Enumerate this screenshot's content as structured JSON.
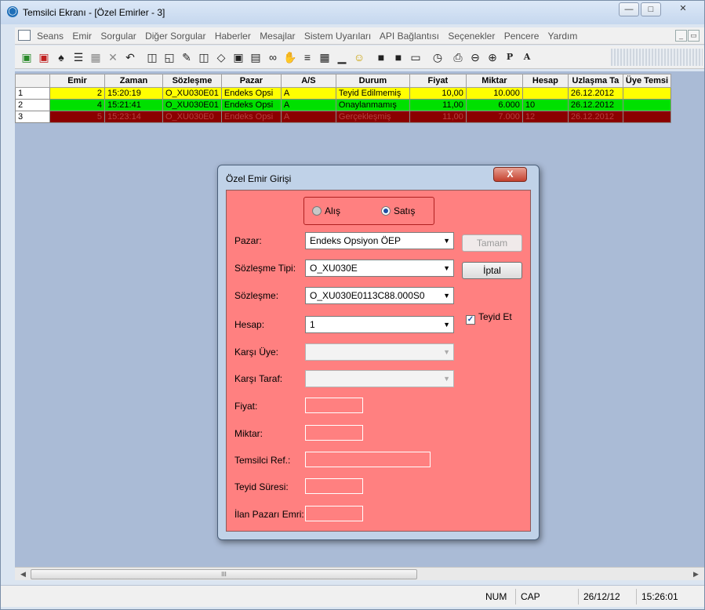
{
  "window": {
    "title": "Temsilci Ekranı - [Özel Emirler - 3]"
  },
  "menu": [
    "Seans",
    "Emir",
    "Sorgular",
    "Diğer Sorgular",
    "Haberler",
    "Mesajlar",
    "Sistem Uyarıları",
    "API Bağlantısı",
    "Seçenekler",
    "Pencere",
    "Yardım"
  ],
  "toolbar": {
    "icons": [
      "new-doc-icon",
      "red-doc-icon",
      "person-icon",
      "book-stack-icon",
      "properties-icon",
      "delete-icon",
      "undo-icon",
      "window-icon",
      "chat-icon",
      "pen-icon",
      "columns-icon",
      "bell-icon",
      "lock-doc-icon",
      "report-icon",
      "glasses-icon",
      "hand-icon",
      "list-icon",
      "grid-icon",
      "chart-icon",
      "smiley-icon",
      "book-icon",
      "book2-icon",
      "inbox-icon",
      "clock-icon",
      "printer-icon",
      "zoom-out-icon",
      "zoom-in-icon",
      "p-icon",
      "a-icon"
    ],
    "p_label": "P",
    "a_label": "A"
  },
  "grid": {
    "columns": [
      "",
      "Emir",
      "Zaman",
      "Sözleşme",
      "Pazar",
      "A/S",
      "Durum",
      "Fiyat",
      "Miktar",
      "Hesap",
      "Uzlaşma Ta",
      "Üye Temsi"
    ],
    "rows": [
      {
        "num": "1",
        "emir": "2",
        "zaman": "15:20:19",
        "sozlesme": "O_XU030E01",
        "pazar": "Endeks Opsi",
        "as": "A",
        "durum": "Teyid Edilmemiş",
        "fiyat": "10,00",
        "miktar": "10.000",
        "hesap": "",
        "uzlasma": "26.12.2012",
        "uye": "",
        "color": "yellow"
      },
      {
        "num": "2",
        "emir": "4",
        "zaman": "15:21:41",
        "sozlesme": "O_XU030E01",
        "pazar": "Endeks Opsi",
        "as": "A",
        "durum": "Onaylanmamış",
        "fiyat": "11,00",
        "miktar": "6.000",
        "hesap": "10",
        "uzlasma": "26.12.2012",
        "uye": "",
        "color": "green"
      },
      {
        "num": "3",
        "emir": "5",
        "zaman": "15:23:14",
        "sozlesme": "O_XU030E0",
        "pazar": "Endeks Opsi",
        "as": "A",
        "durum": "Gerçekleşmiş",
        "fiyat": "11,00",
        "miktar": "7.000",
        "hesap": "12",
        "uzlasma": "26.12.2012",
        "uye": "",
        "color": "darkred"
      }
    ]
  },
  "dialog": {
    "title": "Özel Emir Girişi",
    "close_label": "X",
    "side": {
      "buy_label": "Alış",
      "sell_label": "Satış",
      "selected": "Satış"
    },
    "fields": {
      "pazar": {
        "label": "Pazar:",
        "value": "Endeks Opsiyon ÖEP"
      },
      "sozlesme_tipi": {
        "label": "Sözleşme Tipi:",
        "value": "O_XU030E"
      },
      "sozlesme": {
        "label": "Sözleşme:",
        "value": "O_XU030E0113C88.000S0"
      },
      "hesap": {
        "label": "Hesap:",
        "value": "1"
      },
      "karsi_uye": {
        "label": "Karşı Üye:",
        "value": ""
      },
      "karsi_taraf": {
        "label": "Karşı Taraf:",
        "value": ""
      },
      "fiyat": {
        "label": "Fiyat:",
        "value": ""
      },
      "miktar": {
        "label": "Miktar:",
        "value": ""
      },
      "temsilci_ref": {
        "label": "Temsilci Ref.:",
        "value": ""
      },
      "teyid_suresi": {
        "label": "Teyid Süresi:",
        "value": ""
      },
      "ilan_pazari": {
        "label": "İlan Pazarı Emri:",
        "value": ""
      }
    },
    "ok_label": "Tamam",
    "cancel_label": "İptal",
    "confirm_label": "Teyid Et",
    "confirm_checked": true
  },
  "statusbar": {
    "num": "NUM",
    "cap": "CAP",
    "date": "26/12/12",
    "time": "15:26:01"
  },
  "scrollbar": {
    "thumb_grip": "III"
  }
}
